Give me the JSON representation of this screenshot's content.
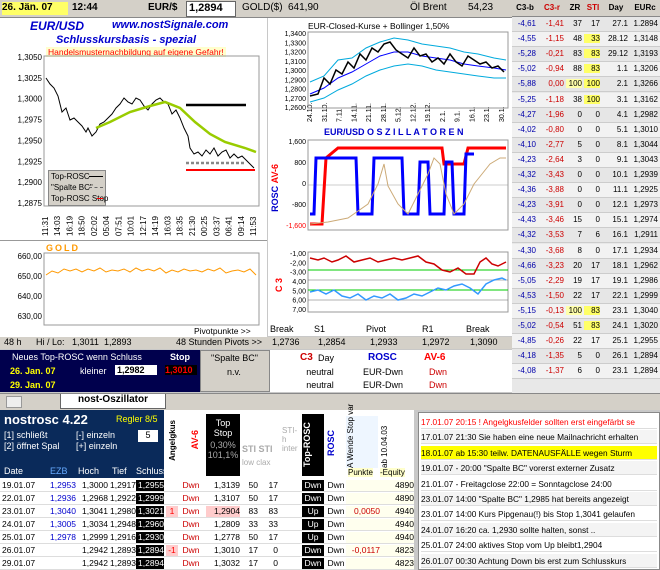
{
  "topbar": {
    "date": "26. Jän. 07",
    "time": "12:44",
    "eur_label": "EUR/$",
    "eur_value": "1,2894",
    "gold_label": "GOLD($)",
    "gold_value": "641,90",
    "oil_label": "Öl Brent",
    "oil_value": "54,23"
  },
  "main_chart": {
    "title": "EUR/USD",
    "site": "www.nostSignale.com",
    "subtitle": "Schlusskursbasis - spezial",
    "warning": "Handelsmusternachbildung auf eigene Gefahr!",
    "yticks": [
      "1,3050",
      "1,3025",
      "1,3000",
      "1,2975",
      "1,2950",
      "1,2925",
      "1,2900",
      "1,2875"
    ],
    "xticks": [
      "11:31",
      "14:03",
      "16:19",
      "18:50",
      "02:02",
      "05:04",
      "07:51",
      "10:01",
      "12:17",
      "14:19",
      "16:03",
      "18:35",
      "21:30",
      "00:25",
      "03:37",
      "06:41",
      "09:14",
      "11:53"
    ],
    "legend": [
      "Top-ROSC",
      "\"Spalte BC\"",
      "Top-ROSC Stop"
    ],
    "legend_colors": [
      "#000000",
      "#aaaaaa",
      "#ff0000"
    ]
  },
  "gold_chart": {
    "label": "GOLD",
    "yticks": [
      "660,00",
      "650,00",
      "640,00",
      "630,00"
    ]
  },
  "bollinger_chart": {
    "title": "EUR-Closed-Kurse + Bollinger 1,50%",
    "yticks": [
      "1,3400",
      "1,3300",
      "1,3200",
      "1,3100",
      "1,3000",
      "1,2900",
      "1,2800",
      "1,2700",
      "1,2600"
    ],
    "xticks": [
      "24.10.",
      "31.10.",
      "7.11.",
      "14.11.",
      "21.11.",
      "28.11.",
      "5.12.",
      "12.12.",
      "19.12.",
      "2.1.",
      "9.1.",
      "16.1.",
      "23.1.",
      "30.1."
    ]
  },
  "oscillator_chart": {
    "title": "EUR/USD   O S Z I L L A T O R E N",
    "rosc_label": "ROSC",
    "av_label": "AV-6",
    "c3_label": "C 3",
    "rosc_yticks": [
      "1,600",
      "800",
      "0",
      "-800",
      "-1,600"
    ],
    "c3_yticks": [
      "-1,00",
      "-2,00",
      "-3,00",
      "4,00",
      "5,00",
      "6,00",
      "7,00"
    ]
  },
  "pivot_bar": {
    "label": "Pivotpunkte >>",
    "cols": [
      "Break",
      "S1",
      "Pivot",
      "R1",
      "Break"
    ],
    "values": [
      "1,2736",
      "1,2854",
      "1,2933",
      "1,2972",
      "1,3090"
    ]
  },
  "hilo_bar": {
    "hours": "48 h",
    "label": "Hi / Lo:",
    "hi": "1,3011",
    "lo": "1,2893",
    "pivots_label": "48 Stunden Pivots >>"
  },
  "signal_box": {
    "header": "Neues Top-ROSC wenn Schluss",
    "stop_label": "Stop",
    "date1": "26. Jan. 07",
    "cond": "kleiner",
    "value": "1,2982",
    "stop": "1,3010",
    "date2": "29. Jan. 07",
    "spalte_label": "\"Spalte BC\"",
    "spalte_value": "n.v."
  },
  "indicator_box": {
    "c3": "C3",
    "day": "Day",
    "rosc": "ROSC",
    "av6": "AV-6",
    "row1": [
      "neutral",
      "EUR-Dwn",
      "Dwn"
    ],
    "row2": [
      "neutral",
      "EUR-Dwn",
      "Dwn"
    ]
  },
  "right_table": {
    "headers": [
      "C3-b",
      "C3-r",
      "ZR",
      "STI",
      "Day",
      "EURc"
    ],
    "rows": [
      [
        "-4,61",
        "-1,41",
        "37",
        "17",
        "27.1",
        "1.2894"
      ],
      [
        "-4,55",
        "-1,15",
        "48",
        "33",
        "28.12",
        "1,3148"
      ],
      [
        "-5,28",
        "-0,21",
        "83",
        "83",
        "29.12",
        "1,3193"
      ],
      [
        "-5,02",
        "-0,94",
        "88",
        "83",
        "1.1",
        "1,3206"
      ],
      [
        "-5,88",
        "0,00",
        "100",
        "100",
        "2.1",
        "1,3266"
      ],
      [
        "-5,25",
        "-1,18",
        "38",
        "100",
        "3.1",
        "1,3162"
      ],
      [
        "-4,27",
        "-1,96",
        "0",
        "0",
        "4.1",
        "1,2982"
      ],
      [
        "-4,02",
        "-0,80",
        "0",
        "0",
        "5.1",
        "1,3010"
      ],
      [
        "-4,10",
        "-2,77",
        "5",
        "0",
        "8.1",
        "1,3044"
      ],
      [
        "-4,23",
        "-2,64",
        "3",
        "0",
        "9.1",
        "1,3043"
      ],
      [
        "-4,32",
        "-3,43",
        "0",
        "0",
        "10.1",
        "1,2939"
      ],
      [
        "-4,36",
        "-3,88",
        "0",
        "0",
        "11.1",
        "1,2925"
      ],
      [
        "-4,23",
        "-3,91",
        "0",
        "0",
        "12.1",
        "1,2973"
      ],
      [
        "-4,43",
        "-3,46",
        "15",
        "0",
        "15.1",
        "1,2974"
      ],
      [
        "-4,32",
        "-3,53",
        "7",
        "6",
        "16.1",
        "1,2911"
      ],
      [
        "-4,30",
        "-3,68",
        "8",
        "0",
        "17.1",
        "1,2934"
      ],
      [
        "-4,66",
        "-3,23",
        "20",
        "17",
        "18.1",
        "1,2962"
      ],
      [
        "-5,05",
        "-2,29",
        "19",
        "17",
        "19.1",
        "1,2986"
      ],
      [
        "-4,53",
        "-1,50",
        "22",
        "17",
        "22.1",
        "1,2999"
      ],
      [
        "-5,15",
        "-0,13",
        "100",
        "83",
        "23.1",
        "1,3040"
      ],
      [
        "-5,02",
        "-0,54",
        "51",
        "83",
        "24.1",
        "1,3020"
      ],
      [
        "-4,85",
        "-0,26",
        "22",
        "17",
        "25.1",
        "1,2955"
      ],
      [
        "-4,18",
        "-1,35",
        "5",
        "0",
        "26.1",
        "1,2894"
      ],
      [
        "-4,08",
        "-1,37",
        "6",
        "0",
        "23.1",
        "1,2894"
      ]
    ]
  },
  "tabbar": {
    "tab_label": "nost-Oszillator"
  },
  "bottom_left": {
    "app_title": "nostrosc 4.22",
    "regler": "Regler 8/5",
    "opt1": "[1] schließt",
    "opt1b": "[-] einzeln",
    "opt2": "[2] öffnet Spal",
    "opt2b": "[+] einzeln",
    "spin_value": "5",
    "headers": [
      "Date",
      "EZB",
      "Hoch",
      "Tief",
      "Schluss"
    ],
    "angel_label": "Angelgkus",
    "av6_label": "AV-6",
    "top_stop_label": "Top Stop",
    "pct1": "0,30%",
    "pct2": "101,1%",
    "sti_label": "STI STI",
    "sti_sub": "low clax",
    "sth_label": "STI-h inter",
    "top_rosc_label": "Top-ROSC",
    "rosc_label": "ROSC",
    "wende_label": "A Wende Stop var",
    "ab_label": "ab 10.04.03",
    "punkte_label": "Punkte",
    "equity_label": "-Equity",
    "rows": [
      [
        "19.01.07",
        "1,2953",
        "1,3000",
        "1,2917",
        "1,2955",
        "",
        "Dwn",
        "1,3139",
        "50",
        "17",
        "",
        "Dwn",
        "Dwn",
        "",
        "4890"
      ],
      [
        "22.01.07",
        "1,2936",
        "1,2968",
        "1,2922",
        "1,2999",
        "",
        "Dwn",
        "1,3107",
        "50",
        "17",
        "",
        "Dwn",
        "Dwn",
        "",
        "4890"
      ],
      [
        "23.01.07",
        "1,3040",
        "1,3041",
        "1,2980",
        "1,3021",
        "1",
        "Dwn",
        "1,2904",
        "83",
        "83",
        "",
        "Up",
        "Dwn",
        "0,0050",
        "4940"
      ],
      [
        "24.01.07",
        "1,3005",
        "1,3034",
        "1,2948",
        "1,2960",
        "",
        "Dwn",
        "1,2809",
        "33",
        "33",
        "",
        "Up",
        "Dwn",
        "",
        "4940"
      ],
      [
        "25.01.07",
        "1,2978",
        "1,2999",
        "1,2916",
        "1,2930",
        "",
        "Dwn",
        "1,2778",
        "50",
        "17",
        "",
        "Up",
        "Dwn",
        "",
        "4940"
      ],
      [
        "26.01.07",
        "",
        "1,2942",
        "1,2893",
        "1,2894",
        "-1",
        "Dwn",
        "1,3010",
        "17",
        "0",
        "",
        "Dwn",
        "Dwn",
        "-0,0117",
        "4823"
      ],
      [
        "29.01.07",
        "",
        "1,2942",
        "1,2893",
        "1,2894",
        "",
        "Dwn",
        "1,3032",
        "17",
        "0",
        "",
        "Dwn",
        "Dwn",
        "",
        "4823"
      ]
    ]
  },
  "news": [
    "17.01.07 20:15 ! Angelgkusfelder sollten erst eingefärbt se",
    "17.01.07 21:30 Sie haben eine neue Mailnachricht erhalten",
    "18.01.07 ab 15:30 teilw. DATENAUSFÄLLE wegen Sturm",
    "19.01.07 - 20:00 \"Spalte BC\" vorerst externer Zusatz",
    "21.01.07 - Freitagclose 22:00 = Sonntagclose 24:00",
    "23.01.07 14:00 \"Spalte BC\" 1,2985 hat bereits angezeigt",
    "23.01.07 14:00 Kurs Pipgenau(!) bis Stop 1,3041 gelaufen",
    "24.01.07 16:20 ca. 1,2930 sollte halten, sonst ..",
    "25.01.07 24:00 aktives Stop vom Up bleibt1,2904",
    "26.01.07 00:30 Achtung Down bis erst zum Schlusskurs"
  ],
  "colors": {
    "accent_red": "#ff0000",
    "accent_blue": "#0000cc",
    "dark_navy": "#00004d",
    "yellow": "#ffff00",
    "green_line": "#99cc00"
  }
}
